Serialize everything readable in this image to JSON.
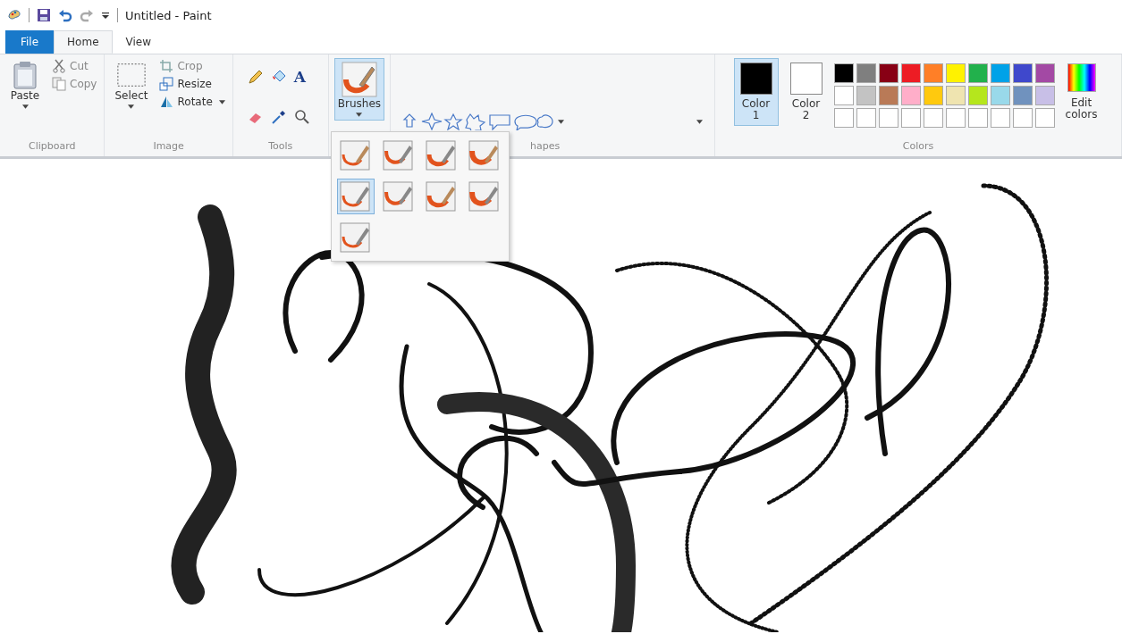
{
  "window": {
    "title": "Untitled - Paint"
  },
  "tabs": [
    {
      "label": "File",
      "kind": "file",
      "selected": false
    },
    {
      "label": "Home",
      "kind": "tab",
      "selected": true
    },
    {
      "label": "View",
      "kind": "tab",
      "selected": false
    }
  ],
  "clipboard": {
    "label": "Clipboard",
    "paste": "Paste",
    "cut": "Cut",
    "copy": "Copy"
  },
  "image": {
    "label": "Image",
    "select": "Select",
    "crop": "Crop",
    "resize": "Resize",
    "rotate": "Rotate"
  },
  "tools": {
    "label": "Tools",
    "text_tool": "A"
  },
  "brushes": {
    "label": "Brushes",
    "expanded": true,
    "items": [
      {
        "selected": false
      },
      {
        "selected": false
      },
      {
        "selected": false
      },
      {
        "selected": false
      },
      {
        "selected": true
      },
      {
        "selected": false
      },
      {
        "selected": false
      },
      {
        "selected": false
      },
      {
        "selected": false
      }
    ]
  },
  "shapes": {
    "label": "hapes"
  },
  "colors": {
    "label": "Colors",
    "color1": {
      "label": "Color",
      "number": "1",
      "color": "#000000",
      "selected": true
    },
    "color2": {
      "label": "Color",
      "number": "2",
      "color": "#ffffff",
      "selected": false
    },
    "palette": [
      {
        "color": "#000000"
      },
      {
        "color": "#7f7f7f"
      },
      {
        "color": "#880015"
      },
      {
        "color": "#ed1c24"
      },
      {
        "color": "#ff7f27"
      },
      {
        "color": "#fff200"
      },
      {
        "color": "#22b14c"
      },
      {
        "color": "#00a2e8"
      },
      {
        "color": "#3f48cc"
      },
      {
        "color": "#a349a4"
      },
      {
        "color": "#ffffff"
      },
      {
        "color": "#c3c3c3"
      },
      {
        "color": "#b97a57"
      },
      {
        "color": "#ffaec9"
      },
      {
        "color": "#ffc90e"
      },
      {
        "color": "#efe4b0"
      },
      {
        "color": "#b5e61d"
      },
      {
        "color": "#99d9ea"
      },
      {
        "color": "#7092be"
      },
      {
        "color": "#c8bfe7"
      }
    ],
    "edit": "Edit colors"
  }
}
